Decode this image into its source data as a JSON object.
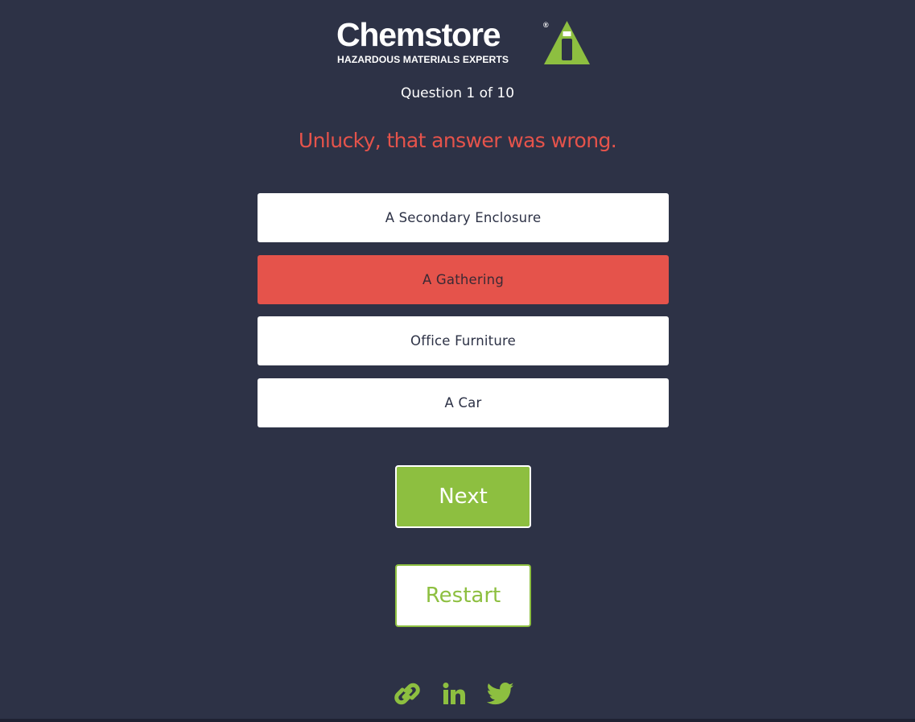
{
  "brand": {
    "name": "Chemstore",
    "registered_mark": "®",
    "tagline": "HAZARDOUS MATERIALS EXPERTS"
  },
  "quiz": {
    "progress": "Question 1 of 10",
    "feedback": "Unlucky, that answer was wrong.",
    "answers": [
      {
        "label": "A Secondary Enclosure",
        "state": "default"
      },
      {
        "label": "A Gathering",
        "state": "wrong-selected"
      },
      {
        "label": "Office Furniture",
        "state": "default"
      },
      {
        "label": "A Car",
        "state": "default"
      }
    ],
    "next_label": "Next",
    "restart_label": "Restart"
  },
  "social": {
    "icons": [
      "link-icon",
      "linkedin-icon",
      "twitter-icon"
    ]
  },
  "colors": {
    "background": "#2d3246",
    "accent_green": "#8dbf40",
    "error_red": "#e5534b",
    "text_white": "#ffffff"
  }
}
